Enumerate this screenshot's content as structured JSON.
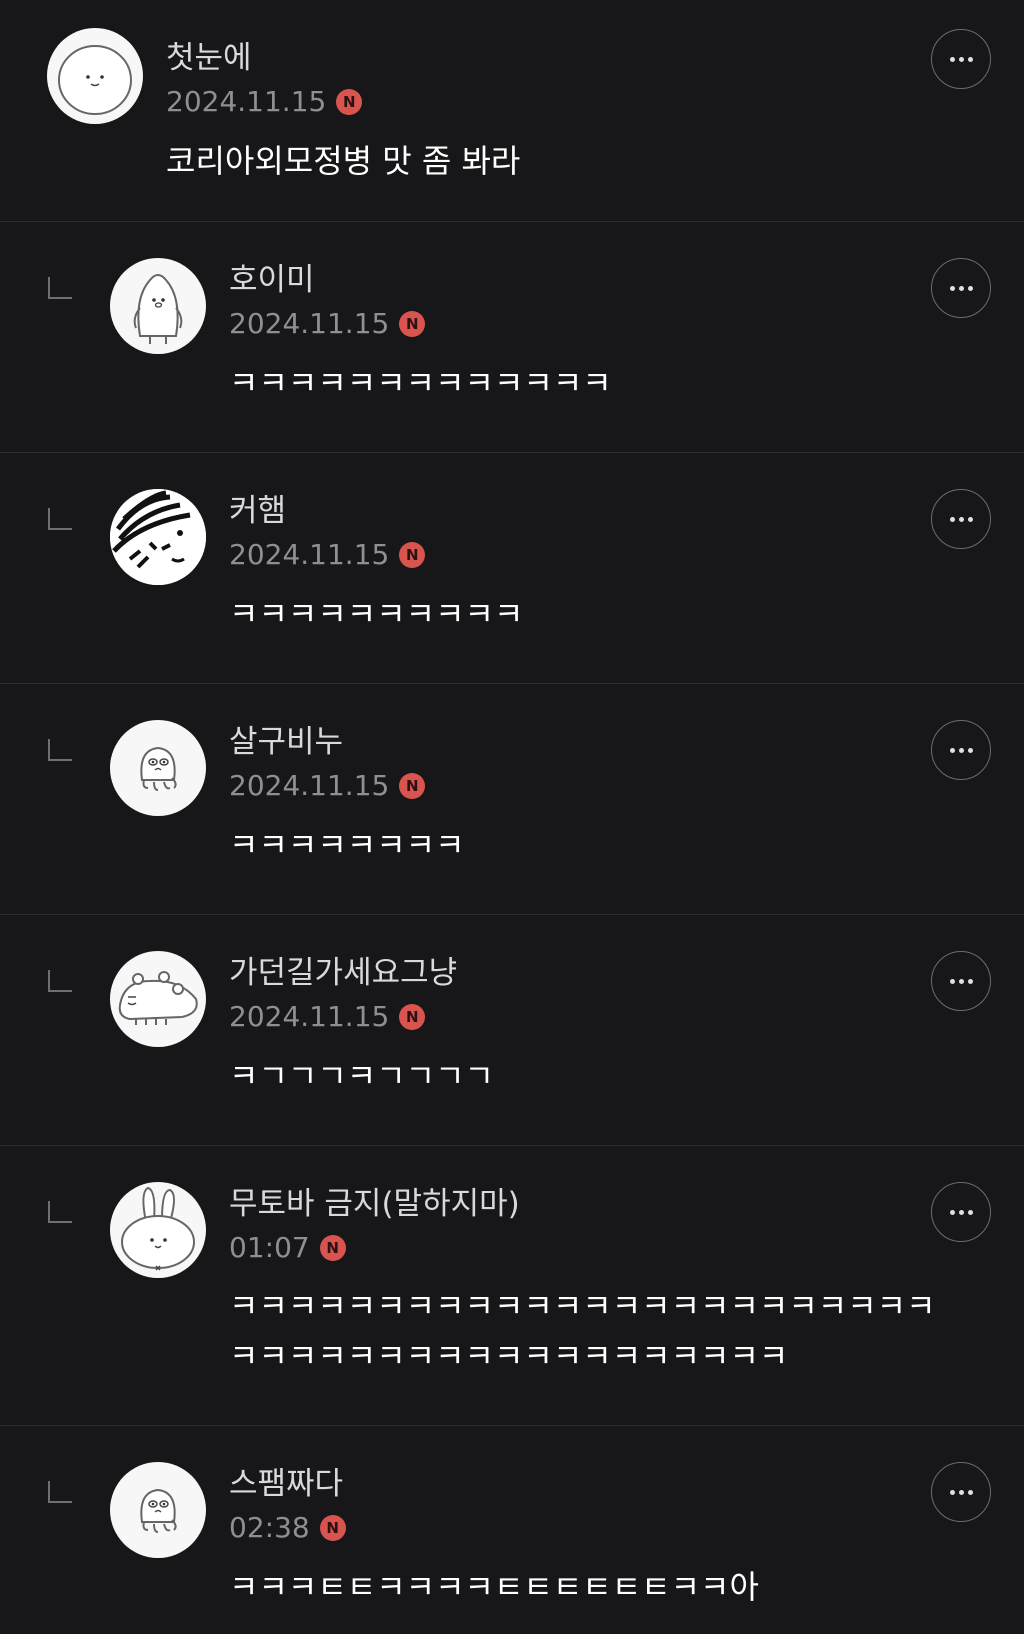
{
  "comments": [
    {
      "nickname": "첫눈에",
      "date": "2024.11.15",
      "badge": "N",
      "text": "코리아외모정병 맛 좀 봐라",
      "avatar": "seal-face-avatar",
      "is_reply": false
    },
    {
      "nickname": "호이미",
      "date": "2024.11.15",
      "badge": "N",
      "text": "ㅋㅋㅋㅋㅋㅋㅋㅋㅋㅋㅋㅋㅋ",
      "avatar": "penguin-avatar",
      "is_reply": true
    },
    {
      "nickname": "커햄",
      "date": "2024.11.15",
      "badge": "N",
      "text": "ㅋㅋㅋㅋㅋㅋㅋㅋㅋㅋ",
      "avatar": "scribble-avatar",
      "is_reply": true
    },
    {
      "nickname": "살구비누",
      "date": "2024.11.15",
      "badge": "N",
      "text": "ㅋㅋㅋㅋㅋㅋㅋㅋ",
      "avatar": "octopus-avatar",
      "is_reply": true
    },
    {
      "nickname": "가던길가세요그냥",
      "date": "2024.11.15",
      "badge": "N",
      "text": "ㅋㄱㄱㄱㅋㄱㄱㄱㄱ",
      "avatar": "hamster-avatar",
      "is_reply": true
    },
    {
      "nickname": "무토바 금지(말하지마)",
      "date": "01:07",
      "badge": "N",
      "text": "ㅋㅋㅋㅋㅋㅋㅋㅋㅋㅋㅋㅋㅋㅋㅋㅋㅋㅋㅋㅋㅋㅋㅋㅋ\nㅋㅋㅋㅋㅋㅋㅋㅋㅋㅋㅋㅋㅋㅋㅋㅋㅋㅋㅋ",
      "avatar": "bunny-avatar",
      "is_reply": true
    },
    {
      "nickname": "스팸짜다",
      "date": "02:38",
      "badge": "N",
      "text": "ㅋㅋㅋㅌㅌㅋㅋㅋㅋㅌㅌㅌㅌㅌㅌㅋㅋ아",
      "avatar": "octopus-avatar",
      "is_reply": true
    }
  ],
  "more_button_label": "more options",
  "colors": {
    "background": "#17171a",
    "divider": "#2c2c31",
    "badge": "#d9534f",
    "date": "#8e8e94"
  }
}
